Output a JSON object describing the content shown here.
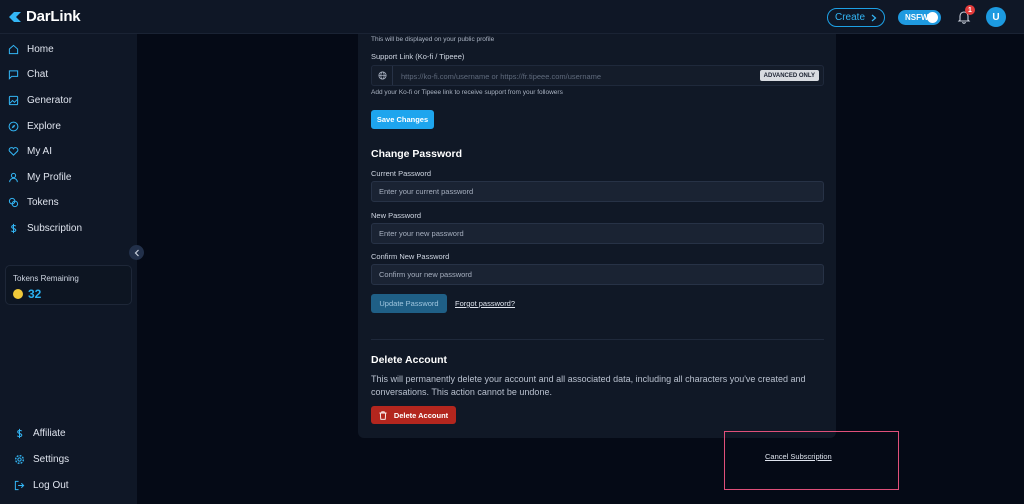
{
  "brand": {
    "name": "DarLink"
  },
  "header": {
    "create_label": "Create",
    "nsfw_label": "NSFW",
    "notification_count": "1",
    "avatar_initial": "U"
  },
  "sidebar": {
    "items": [
      {
        "label": "Home",
        "icon": "home-icon"
      },
      {
        "label": "Chat",
        "icon": "chat-icon"
      },
      {
        "label": "Generator",
        "icon": "image-icon"
      },
      {
        "label": "Explore",
        "icon": "compass-icon"
      },
      {
        "label": "My AI",
        "icon": "heart-icon"
      },
      {
        "label": "My Profile",
        "icon": "user-icon"
      },
      {
        "label": "Tokens",
        "icon": "coins-icon"
      },
      {
        "label": "Subscription",
        "icon": "dollar-icon"
      }
    ],
    "tokens": {
      "label": "Tokens Remaining",
      "value": "32"
    },
    "bottom_items": [
      {
        "label": "Affiliate",
        "icon": "dollar-icon"
      },
      {
        "label": "Settings",
        "icon": "gear-icon"
      },
      {
        "label": "Log Out",
        "icon": "logout-icon"
      }
    ]
  },
  "profile": {
    "public_hint": "This will be displayed on your public profile",
    "support_label": "Support Link (Ko-fi / Tipeee)",
    "support_placeholder": "https://ko-fi.com/username or https://fr.tipeee.com/username",
    "advanced_badge": "ADVANCED ONLY",
    "support_hint": "Add your Ko-fi or Tipeee link to receive support from your followers",
    "save_label": "Save Changes"
  },
  "password": {
    "title": "Change Password",
    "current_label": "Current Password",
    "current_placeholder": "Enter your current password",
    "new_label": "New Password",
    "new_placeholder": "Enter your new password",
    "confirm_label": "Confirm New Password",
    "confirm_placeholder": "Confirm your new password",
    "update_label": "Update Password",
    "forgot_label": "Forgot password?"
  },
  "delete": {
    "title": "Delete Account",
    "description": "This will permanently delete your account and all associated data, including all characters you've created and conversations. This action cannot be undone.",
    "button_label": "Delete Account"
  },
  "subscription": {
    "cancel_label": "Cancel Subscription"
  },
  "colors": {
    "accent": "#1ea5ee",
    "danger": "#b3261e",
    "highlight": "#e0507a"
  }
}
